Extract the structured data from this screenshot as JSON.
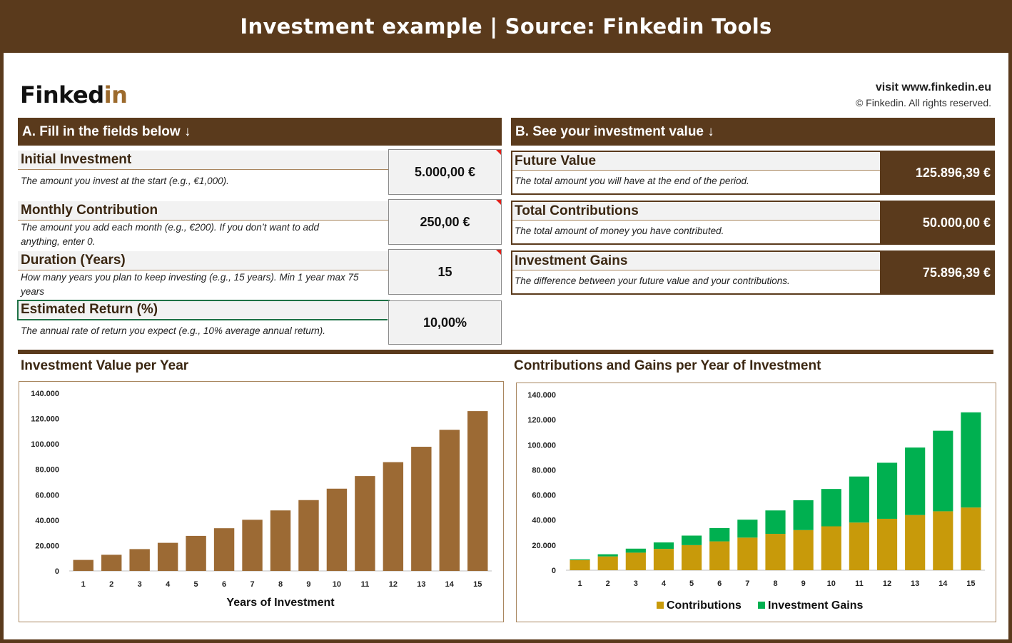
{
  "banner": {
    "title": "Investment example | Source: Finkedin Tools"
  },
  "brand": {
    "logo_main": "Finked",
    "logo_accent": "in",
    "visit": "visit www.finkedin.eu",
    "copyright": "© Finkedin. All rights reserved."
  },
  "sectionA": {
    "title": "A. Fill in the fields below ↓",
    "fields": [
      {
        "label": "Initial Investment",
        "desc": "The amount you invest at the start (e.g., €1,000).",
        "value": "5.000,00 €"
      },
      {
        "label": "Monthly Contribution",
        "desc": "The amount you add each month (e.g., €200). If you don’t want to add anything, enter 0.",
        "value": "250,00 €"
      },
      {
        "label": "Duration (Years)",
        "desc": "How many years you plan to keep investing (e.g., 15 years). Min 1 year max 75 years",
        "value": "15"
      },
      {
        "label": "Estimated Return (%)",
        "desc": "The annual rate of return you expect (e.g., 10% average annual return).",
        "value": "10,00%"
      }
    ]
  },
  "sectionB": {
    "title": "B. See your investment value ↓",
    "results": [
      {
        "label": "Future Value",
        "desc": "The total amount you will have at the end of the period.",
        "value": "125.896,39 €"
      },
      {
        "label": "Total Contributions",
        "desc": "The total amount of money you have contributed.",
        "value": "50.000,00 €"
      },
      {
        "label": "Investment Gains",
        "desc": "The difference between your future value and your contributions.",
        "value": "75.896,39 €"
      }
    ]
  },
  "colors": {
    "brown": "#5a3a1c",
    "bar_brown": "#9c6a34",
    "contrib": "#c89a0a",
    "gains": "#00b050"
  },
  "chart_data": [
    {
      "type": "bar",
      "title": "Investment Value per Year",
      "xlabel": "Years of Investment",
      "ylabel": "",
      "ylim": [
        0,
        140000
      ],
      "y_ticks": [
        "0",
        "20.000",
        "40.000",
        "60.000",
        "80.000",
        "100.000",
        "120.000",
        "140.000"
      ],
      "categories": [
        "1",
        "2",
        "3",
        "4",
        "5",
        "6",
        "7",
        "8",
        "9",
        "10",
        "11",
        "12",
        "13",
        "14",
        "15"
      ],
      "series": [
        {
          "values": [
            8668,
            12720,
            17196,
            22141,
            27604,
            33638,
            40305,
            47670,
            55806,
            64795,
            74725,
            85694,
            97813,
            111200,
            125896
          ]
        }
      ],
      "grid": false
    },
    {
      "type": "bar",
      "stacked": true,
      "title": "Contributions and Gains per Year of Investment",
      "xlabel": "",
      "ylabel": "",
      "ylim": [
        0,
        140000
      ],
      "y_ticks": [
        "0",
        "20.000",
        "40.000",
        "60.000",
        "80.000",
        "100.000",
        "120.000",
        "140.000"
      ],
      "categories": [
        "1",
        "2",
        "3",
        "4",
        "5",
        "6",
        "7",
        "8",
        "9",
        "10",
        "11",
        "12",
        "13",
        "14",
        "15"
      ],
      "series": [
        {
          "name": "Contributions",
          "values": [
            8000,
            11000,
            14000,
            17000,
            20000,
            23000,
            26000,
            29000,
            32000,
            35000,
            38000,
            41000,
            44000,
            47000,
            50000
          ]
        },
        {
          "name": "Investment Gains",
          "values": [
            668,
            1720,
            3196,
            5141,
            7604,
            10638,
            14305,
            18670,
            23806,
            29795,
            36725,
            44694,
            53813,
            64200,
            75896
          ]
        }
      ],
      "legend": "bottom",
      "grid": false
    }
  ]
}
